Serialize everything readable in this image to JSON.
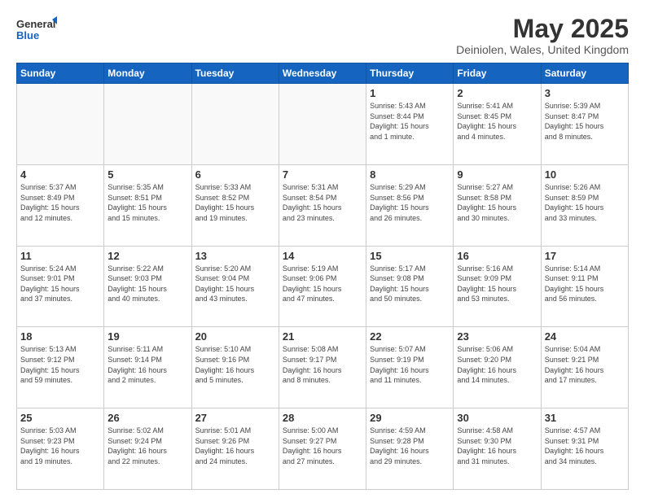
{
  "header": {
    "logo_general": "General",
    "logo_blue": "Blue",
    "month_title": "May 2025",
    "location": "Deiniolen, Wales, United Kingdom"
  },
  "days_of_week": [
    "Sunday",
    "Monday",
    "Tuesday",
    "Wednesday",
    "Thursday",
    "Friday",
    "Saturday"
  ],
  "weeks": [
    [
      {
        "day": "",
        "info": ""
      },
      {
        "day": "",
        "info": ""
      },
      {
        "day": "",
        "info": ""
      },
      {
        "day": "",
        "info": ""
      },
      {
        "day": "1",
        "info": "Sunrise: 5:43 AM\nSunset: 8:44 PM\nDaylight: 15 hours\nand 1 minute."
      },
      {
        "day": "2",
        "info": "Sunrise: 5:41 AM\nSunset: 8:45 PM\nDaylight: 15 hours\nand 4 minutes."
      },
      {
        "day": "3",
        "info": "Sunrise: 5:39 AM\nSunset: 8:47 PM\nDaylight: 15 hours\nand 8 minutes."
      }
    ],
    [
      {
        "day": "4",
        "info": "Sunrise: 5:37 AM\nSunset: 8:49 PM\nDaylight: 15 hours\nand 12 minutes."
      },
      {
        "day": "5",
        "info": "Sunrise: 5:35 AM\nSunset: 8:51 PM\nDaylight: 15 hours\nand 15 minutes."
      },
      {
        "day": "6",
        "info": "Sunrise: 5:33 AM\nSunset: 8:52 PM\nDaylight: 15 hours\nand 19 minutes."
      },
      {
        "day": "7",
        "info": "Sunrise: 5:31 AM\nSunset: 8:54 PM\nDaylight: 15 hours\nand 23 minutes."
      },
      {
        "day": "8",
        "info": "Sunrise: 5:29 AM\nSunset: 8:56 PM\nDaylight: 15 hours\nand 26 minutes."
      },
      {
        "day": "9",
        "info": "Sunrise: 5:27 AM\nSunset: 8:58 PM\nDaylight: 15 hours\nand 30 minutes."
      },
      {
        "day": "10",
        "info": "Sunrise: 5:26 AM\nSunset: 8:59 PM\nDaylight: 15 hours\nand 33 minutes."
      }
    ],
    [
      {
        "day": "11",
        "info": "Sunrise: 5:24 AM\nSunset: 9:01 PM\nDaylight: 15 hours\nand 37 minutes."
      },
      {
        "day": "12",
        "info": "Sunrise: 5:22 AM\nSunset: 9:03 PM\nDaylight: 15 hours\nand 40 minutes."
      },
      {
        "day": "13",
        "info": "Sunrise: 5:20 AM\nSunset: 9:04 PM\nDaylight: 15 hours\nand 43 minutes."
      },
      {
        "day": "14",
        "info": "Sunrise: 5:19 AM\nSunset: 9:06 PM\nDaylight: 15 hours\nand 47 minutes."
      },
      {
        "day": "15",
        "info": "Sunrise: 5:17 AM\nSunset: 9:08 PM\nDaylight: 15 hours\nand 50 minutes."
      },
      {
        "day": "16",
        "info": "Sunrise: 5:16 AM\nSunset: 9:09 PM\nDaylight: 15 hours\nand 53 minutes."
      },
      {
        "day": "17",
        "info": "Sunrise: 5:14 AM\nSunset: 9:11 PM\nDaylight: 15 hours\nand 56 minutes."
      }
    ],
    [
      {
        "day": "18",
        "info": "Sunrise: 5:13 AM\nSunset: 9:12 PM\nDaylight: 15 hours\nand 59 minutes."
      },
      {
        "day": "19",
        "info": "Sunrise: 5:11 AM\nSunset: 9:14 PM\nDaylight: 16 hours\nand 2 minutes."
      },
      {
        "day": "20",
        "info": "Sunrise: 5:10 AM\nSunset: 9:16 PM\nDaylight: 16 hours\nand 5 minutes."
      },
      {
        "day": "21",
        "info": "Sunrise: 5:08 AM\nSunset: 9:17 PM\nDaylight: 16 hours\nand 8 minutes."
      },
      {
        "day": "22",
        "info": "Sunrise: 5:07 AM\nSunset: 9:19 PM\nDaylight: 16 hours\nand 11 minutes."
      },
      {
        "day": "23",
        "info": "Sunrise: 5:06 AM\nSunset: 9:20 PM\nDaylight: 16 hours\nand 14 minutes."
      },
      {
        "day": "24",
        "info": "Sunrise: 5:04 AM\nSunset: 9:21 PM\nDaylight: 16 hours\nand 17 minutes."
      }
    ],
    [
      {
        "day": "25",
        "info": "Sunrise: 5:03 AM\nSunset: 9:23 PM\nDaylight: 16 hours\nand 19 minutes."
      },
      {
        "day": "26",
        "info": "Sunrise: 5:02 AM\nSunset: 9:24 PM\nDaylight: 16 hours\nand 22 minutes."
      },
      {
        "day": "27",
        "info": "Sunrise: 5:01 AM\nSunset: 9:26 PM\nDaylight: 16 hours\nand 24 minutes."
      },
      {
        "day": "28",
        "info": "Sunrise: 5:00 AM\nSunset: 9:27 PM\nDaylight: 16 hours\nand 27 minutes."
      },
      {
        "day": "29",
        "info": "Sunrise: 4:59 AM\nSunset: 9:28 PM\nDaylight: 16 hours\nand 29 minutes."
      },
      {
        "day": "30",
        "info": "Sunrise: 4:58 AM\nSunset: 9:30 PM\nDaylight: 16 hours\nand 31 minutes."
      },
      {
        "day": "31",
        "info": "Sunrise: 4:57 AM\nSunset: 9:31 PM\nDaylight: 16 hours\nand 34 minutes."
      }
    ]
  ]
}
